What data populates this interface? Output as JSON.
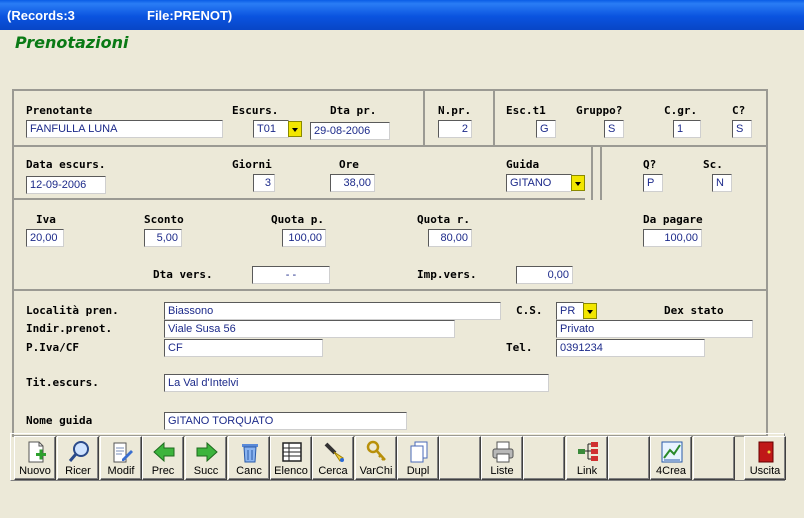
{
  "window": {
    "records": "(Records:3",
    "file": "File:PRENOT)"
  },
  "heading": "Prenotazioni",
  "labels": {
    "prenotante": "Prenotante",
    "escurs": "Escurs.",
    "dta_pr": "Dta pr.",
    "n_pr": "N.pr.",
    "esc_t1": "Esc.t1",
    "gruppo": "Gruppo?",
    "c_gr": "C.gr.",
    "c_q": "C?",
    "data_escurs": "Data escurs.",
    "giorni": "Giorni",
    "ore": "Ore",
    "guida": "Guida",
    "q_q": "Q?",
    "sc": "Sc.",
    "iva": "Iva",
    "sconto": "Sconto",
    "quota_p": "Quota p.",
    "quota_r": "Quota r.",
    "da_pagare": "Da pagare",
    "dta_vers": "Dta vers.",
    "imp_vers": "Imp.vers.",
    "localita": "Località pren.",
    "cs": "C.S.",
    "dex_stato": "Dex stato",
    "indir": "Indir.prenot.",
    "piva": "P.Iva/CF",
    "tel": "Tel.",
    "tit_escurs": "Tit.escurs.",
    "nome_guida": "Nome guida"
  },
  "values": {
    "prenotante": "FANFULLA LUNA",
    "escurs": "T01",
    "dta_pr": "29-08-2006",
    "n_pr": "2",
    "esc_t1": "G",
    "gruppo": "S",
    "c_gr": "1",
    "c_q": "S",
    "data_escurs": "12-09-2006",
    "giorni": "3",
    "ore": "38,00",
    "guida": "GITANO",
    "q_q": "P",
    "sc": "N",
    "iva": "20,00",
    "sconto": "5,00",
    "quota_p": "100,00",
    "quota_r": "80,00",
    "da_pagare": "100,00",
    "dta_vers": "  -   -",
    "imp_vers": "0,00",
    "localita": "Biassono",
    "cs": "PR",
    "dex_stato": "Privato",
    "indir": "Viale Susa 56",
    "piva": "CF",
    "tel": "0391234",
    "tit_escurs": "La Val d'Intelvi",
    "nome_guida": "GITANO TORQUATO"
  },
  "toolbar": {
    "nuovo": "Nuovo",
    "ricer": "Ricer",
    "modif": "Modif",
    "prec": "Prec",
    "succ": "Succ",
    "canc": "Canc",
    "elenco": "Elenco",
    "cerca": "Cerca",
    "varchi": "VarChi",
    "dupl": "Dupl",
    "liste": "Liste",
    "link": "Link",
    "crea": "4Crea",
    "uscita": "Uscita"
  },
  "colors": {
    "title_bar": "#0a53df",
    "heading": "#0a7a15",
    "field_text": "#1c2a8a",
    "dropdown": "#f2e600",
    "face": "#ece9d8"
  },
  "icons": {
    "nuovo": "new-document-icon",
    "ricer": "magnifier-icon",
    "modif": "edit-document-icon",
    "prec": "arrow-left-icon",
    "succ": "arrow-right-icon",
    "canc": "trash-icon",
    "elenco": "table-list-icon",
    "cerca": "search-flashlight-icon",
    "varchi": "keys-icon",
    "dupl": "duplicate-icon",
    "liste": "printer-icon",
    "link": "link-tree-icon",
    "crea": "create-chart-icon",
    "uscita": "exit-door-icon"
  }
}
